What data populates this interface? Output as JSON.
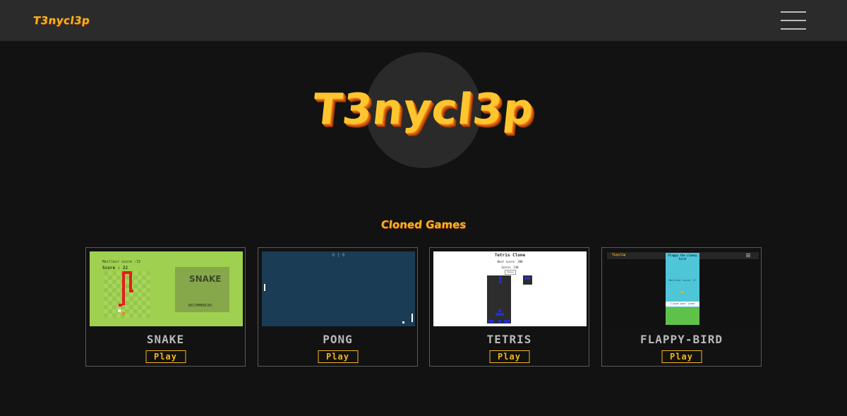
{
  "header": {
    "brand": "T3nycl3p",
    "menu_icon": "hamburger-menu-icon"
  },
  "hero": {
    "title": "T3nycl3p"
  },
  "section": {
    "title": "Cloned Games"
  },
  "games": [
    {
      "name": "SNAKE",
      "play_label": "Play",
      "thumb": {
        "best_score": "Meilleur score :15",
        "score": "Score : 22",
        "logo": "SNAKE",
        "button": "RECOMMENCER"
      }
    },
    {
      "name": "PONG",
      "play_label": "Play",
      "thumb": {
        "score": "0 | 0"
      }
    },
    {
      "name": "TETRIS",
      "play_label": "Play",
      "thumb": {
        "title": "Tetris Clone",
        "best_score": "Best score: 390",
        "score": "Score: 130",
        "button": "Pause"
      }
    },
    {
      "name": "FLAPPY-BIRD",
      "play_label": "Play",
      "thumb": {
        "brand": "Tinyclip",
        "title": "Flappy the clumsy bird",
        "best_score": "Meilleur score: 27",
        "hint": "Clique pour jouer"
      }
    }
  ],
  "colors": {
    "accent": "#f3b51e",
    "background": "#121212",
    "topbar": "#2b2b2b"
  }
}
